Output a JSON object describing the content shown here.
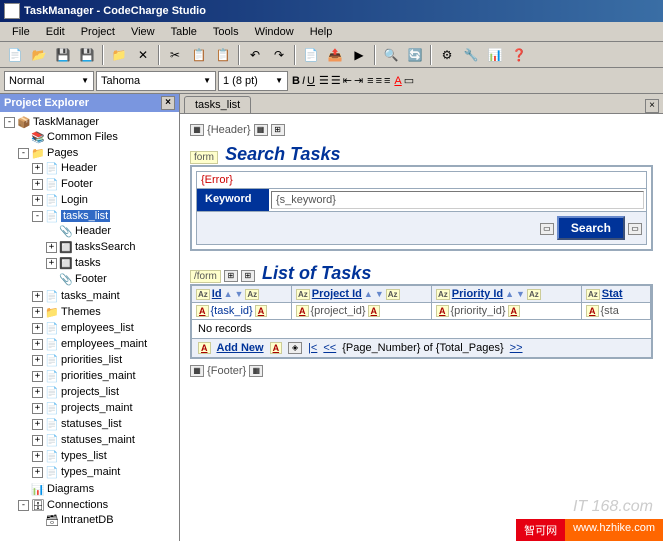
{
  "window": {
    "title": "TaskManager - CodeCharge Studio"
  },
  "menu": {
    "file": "File",
    "edit": "Edit",
    "project": "Project",
    "view": "View",
    "table": "Table",
    "tools": "Tools",
    "window": "Window",
    "help": "Help"
  },
  "format": {
    "style": "Normal",
    "font": "Tahoma",
    "size": "1 (8 pt)"
  },
  "sidebar": {
    "title": "Project Explorer",
    "root": "TaskManager",
    "common": "Common Files",
    "pages": "Pages",
    "nodes": [
      "Header",
      "Footer",
      "Login"
    ],
    "tasks_list": "tasks_list",
    "tasks_children": [
      "Header",
      "tasksSearch",
      "tasks",
      "Footer"
    ],
    "rest": [
      "tasks_maint",
      "Themes",
      "employees_list",
      "employees_maint",
      "priorities_list",
      "priorities_maint",
      "projects_list",
      "projects_maint",
      "statuses_list",
      "statuses_maint",
      "types_list",
      "types_maint"
    ],
    "diagrams": "Diagrams",
    "connections": "Connections",
    "db": "IntranetDB"
  },
  "tab": "tasks_list",
  "canvas": {
    "header_tag": "{Header}",
    "form_open": "form",
    "form_close": "/form",
    "search_title": "Search Tasks",
    "error": "{Error}",
    "keyword_label": "Keyword",
    "keyword_value": "{s_keyword}",
    "search_btn": "Search",
    "list_title": "List of Tasks",
    "cols": {
      "id": "Id",
      "project": "Project Id",
      "priority": "Priority Id",
      "status": "Stat"
    },
    "vals": {
      "id": "{task_id}",
      "project": "{project_id}",
      "priority": "{priority_id}",
      "status": "{sta"
    },
    "norec": "No records",
    "addnew": "Add New",
    "nav_first": "|<",
    "nav_prev": "<<",
    "nav_next": ">>",
    "pager": "{Page_Number} of {Total_Pages}",
    "footer_tag": "{Footer}"
  },
  "watermark": "IT 168.com",
  "badges": {
    "b1": "智可网",
    "b2": "www.hzhike.com"
  }
}
